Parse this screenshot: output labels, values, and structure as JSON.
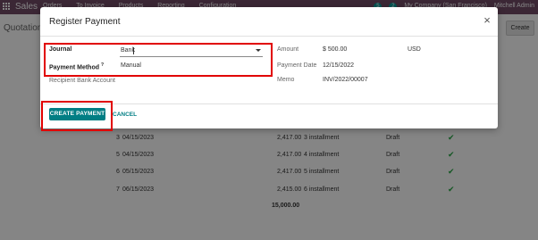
{
  "app": {
    "brand": "Sales",
    "menu": [
      "Orders",
      "To Invoice",
      "Products",
      "Reporting",
      "Configuration"
    ],
    "badge_messages": "5",
    "badge_activities": "2",
    "company": "My Company (San Francisco)",
    "user": "Mitchell Admin",
    "page_title": "Quotation",
    "create_label": "Create"
  },
  "modal": {
    "title": "Register Payment",
    "close_glyph": "×",
    "journal_label": "Journal",
    "journal_value": "Bank",
    "payment_method_label": "Payment Method",
    "payment_method_help": "?",
    "payment_method_value": "Manual",
    "recipient_label": "Recipient Bank Account",
    "amount_label": "Amount",
    "amount_value": "$ 500.00",
    "currency_value": "USD",
    "payment_date_label": "Payment Date",
    "payment_date_value": "12/15/2022",
    "memo_label": "Memo",
    "memo_value": "INV/2022/00007",
    "create_payment_label": "CREATE PAYMENT",
    "cancel_label": "CANCEL"
  },
  "installments": {
    "rows": [
      {
        "num": "3",
        "date": "04/15/2023",
        "amount": "2,417.00",
        "label": "3 installment",
        "status": "Draft"
      },
      {
        "num": "5",
        "date": "04/15/2023",
        "amount": "2,417.00",
        "label": "4 installment",
        "status": "Draft"
      },
      {
        "num": "6",
        "date": "05/15/2023",
        "amount": "2,417.00",
        "label": "5 installment",
        "status": "Draft"
      },
      {
        "num": "7",
        "date": "06/15/2023",
        "amount": "2,415.00",
        "label": "6 installment",
        "status": "Draft"
      }
    ],
    "total": "15,000.00"
  },
  "colors": {
    "navbar": "#714b67",
    "primary_button": "#017e84",
    "highlight": "#e10000",
    "check": "#28a745"
  }
}
